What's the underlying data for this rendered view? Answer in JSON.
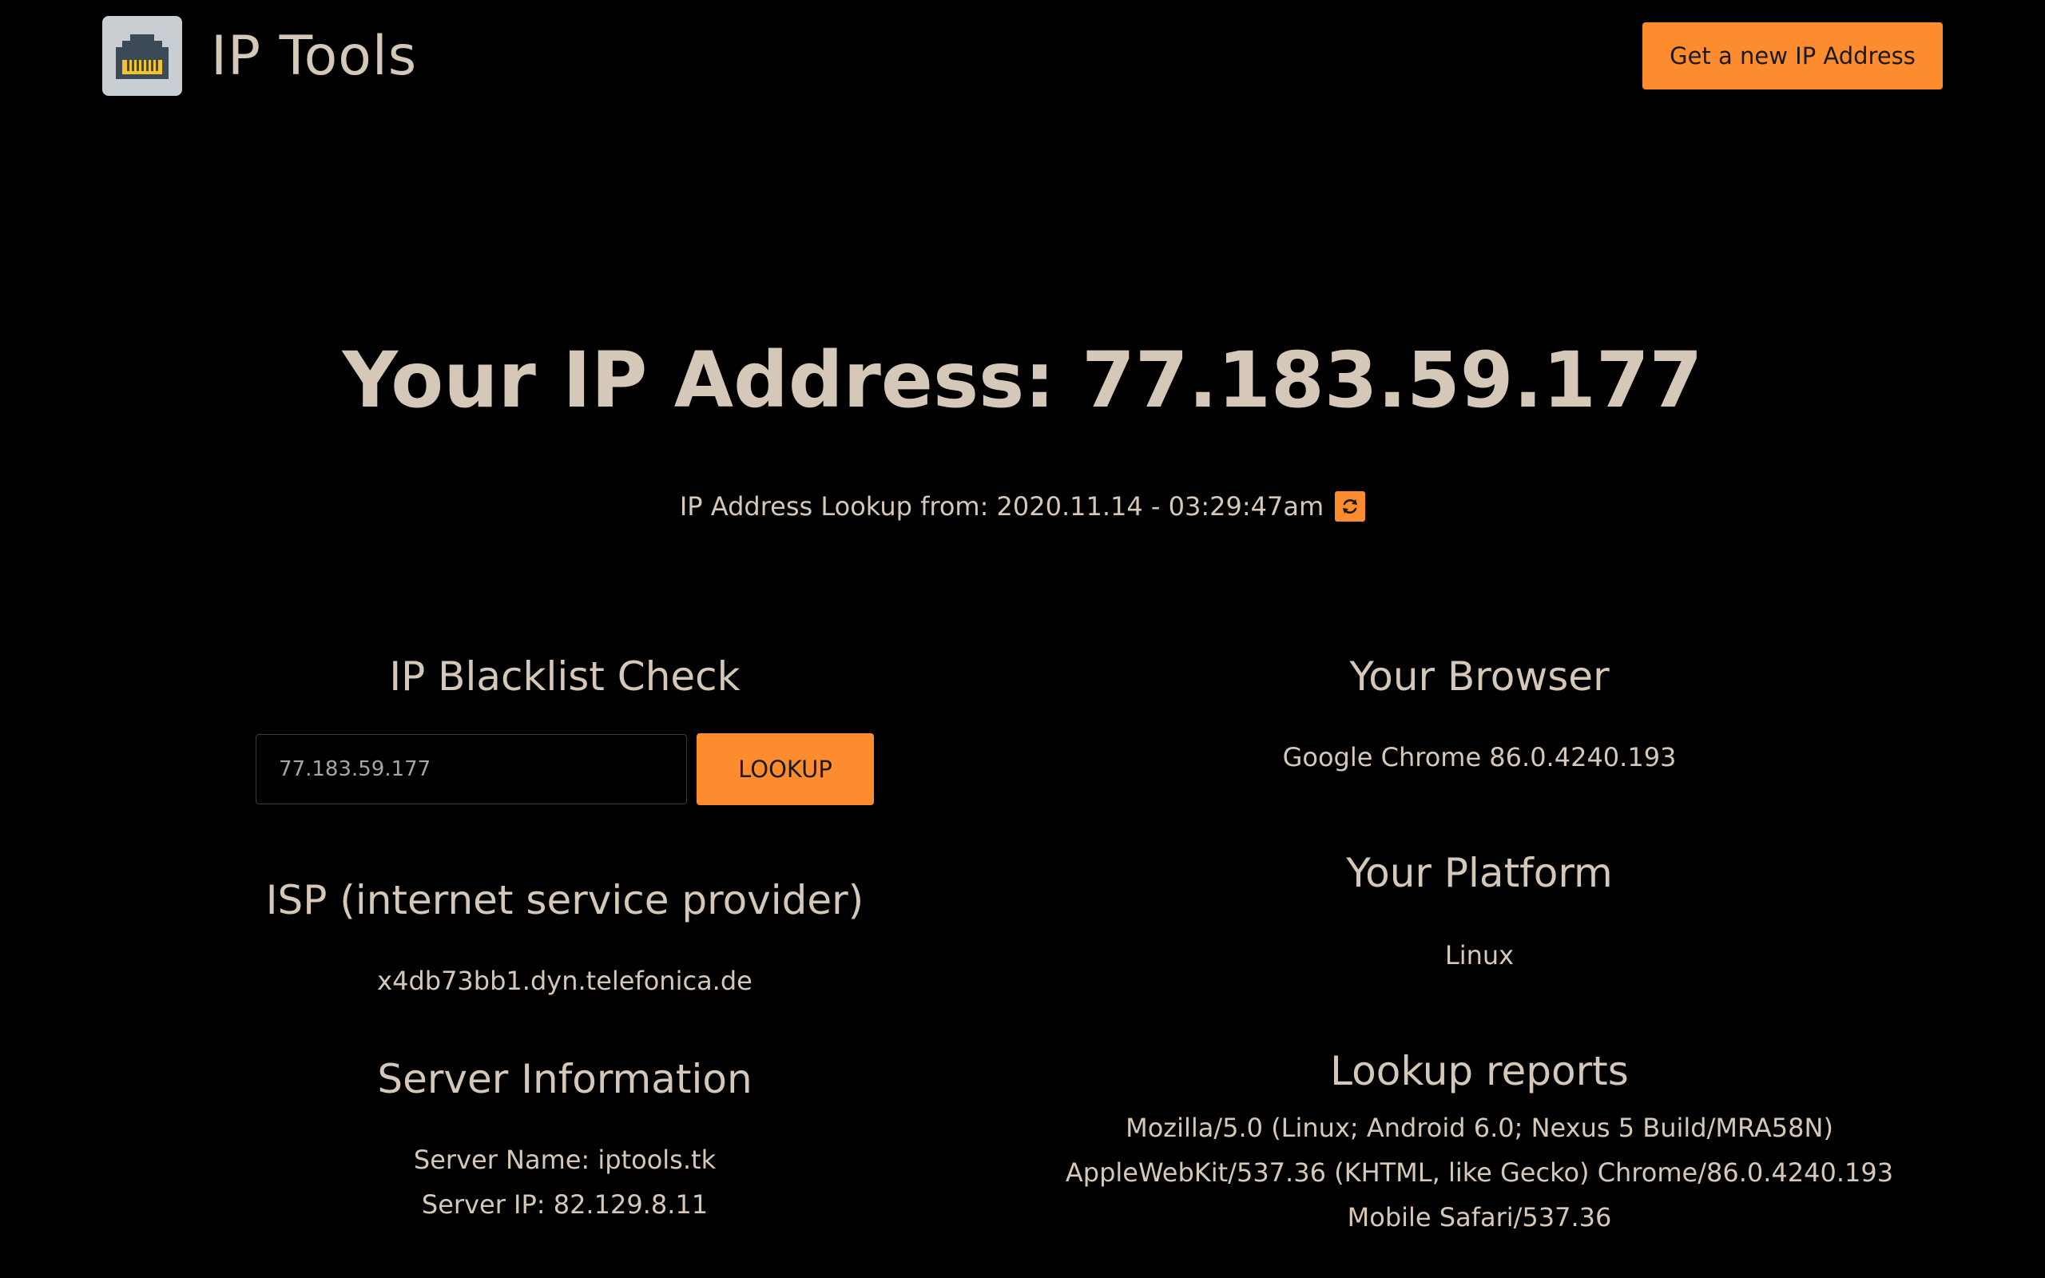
{
  "header": {
    "brand_title": "IP Tools",
    "new_ip_button": "Get a new IP Address"
  },
  "hero": {
    "title": "Your IP Address: 77.183.59.177",
    "lookup_line": "IP Address Lookup from: 2020.11.14 - 03:29:47am"
  },
  "blacklist": {
    "title": "IP Blacklist Check",
    "input_value": "77.183.59.177",
    "lookup_button": "LOOKUP"
  },
  "isp": {
    "title": "ISP (internet service provider)",
    "value": "x4db73bb1.dyn.telefonica.de"
  },
  "server": {
    "title": "Server Information",
    "name_line": "Server Name: iptools.tk",
    "ip_line": "Server IP: 82.129.8.11"
  },
  "browser": {
    "title": "Your Browser",
    "value": "Google Chrome 86.0.4240.193"
  },
  "platform": {
    "title": "Your Platform",
    "value": "Linux"
  },
  "reports": {
    "title": "Lookup reports",
    "lines": [
      "Mozilla/5.0 (Linux; Android 6.0; Nexus 5 Build/MRA58N)",
      "AppleWebKit/537.36 (KHTML, like Gecko) Chrome/86.0.4240.193",
      "Mobile Safari/537.36"
    ]
  },
  "icons": {
    "logo": "ethernet-port-icon",
    "refresh": "refresh-icon"
  },
  "colors": {
    "background": "#000000",
    "text": "#d6c8b8",
    "accent": "#fd8c2f",
    "logo_bg": "#c9ced3",
    "port_body": "#3c4a57",
    "port_pins": "#f2c230"
  }
}
